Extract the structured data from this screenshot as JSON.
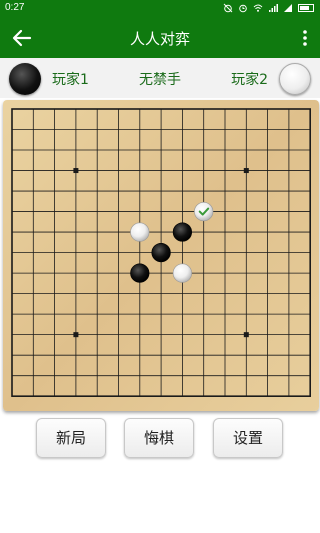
{
  "status_bar": {
    "time": "0:27",
    "icons": [
      "alarm-off-icon",
      "alarm-icon",
      "wifi-icon",
      "signal-hd-icon",
      "signal-icon",
      "battery-icon"
    ]
  },
  "toolbar": {
    "title": "人人对弈",
    "back_icon": "arrow-left-icon",
    "more_icon": "more-vertical-icon"
  },
  "players": {
    "player1_label": "玩家1",
    "player1_stone": "black",
    "mode_label": "无禁手",
    "player2_label": "玩家2",
    "player2_stone": "white"
  },
  "board": {
    "size": 15,
    "star_points": [
      [
        3,
        3
      ],
      [
        11,
        3
      ],
      [
        3,
        11
      ],
      [
        11,
        11
      ]
    ],
    "stones": [
      {
        "col": 9,
        "row": 5,
        "color": "white",
        "last_move": true
      },
      {
        "col": 6,
        "row": 6,
        "color": "white"
      },
      {
        "col": 8,
        "row": 6,
        "color": "black"
      },
      {
        "col": 7,
        "row": 7,
        "color": "black"
      },
      {
        "col": 6,
        "row": 8,
        "color": "black"
      },
      {
        "col": 8,
        "row": 8,
        "color": "white"
      }
    ],
    "colors": {
      "wood": "#e4c894",
      "line": "#1a1a1a",
      "accent": "#0f7a0f",
      "mark": "#3a9a3a"
    }
  },
  "actions": {
    "new_game": "新局",
    "undo": "悔棋",
    "settings": "设置"
  }
}
